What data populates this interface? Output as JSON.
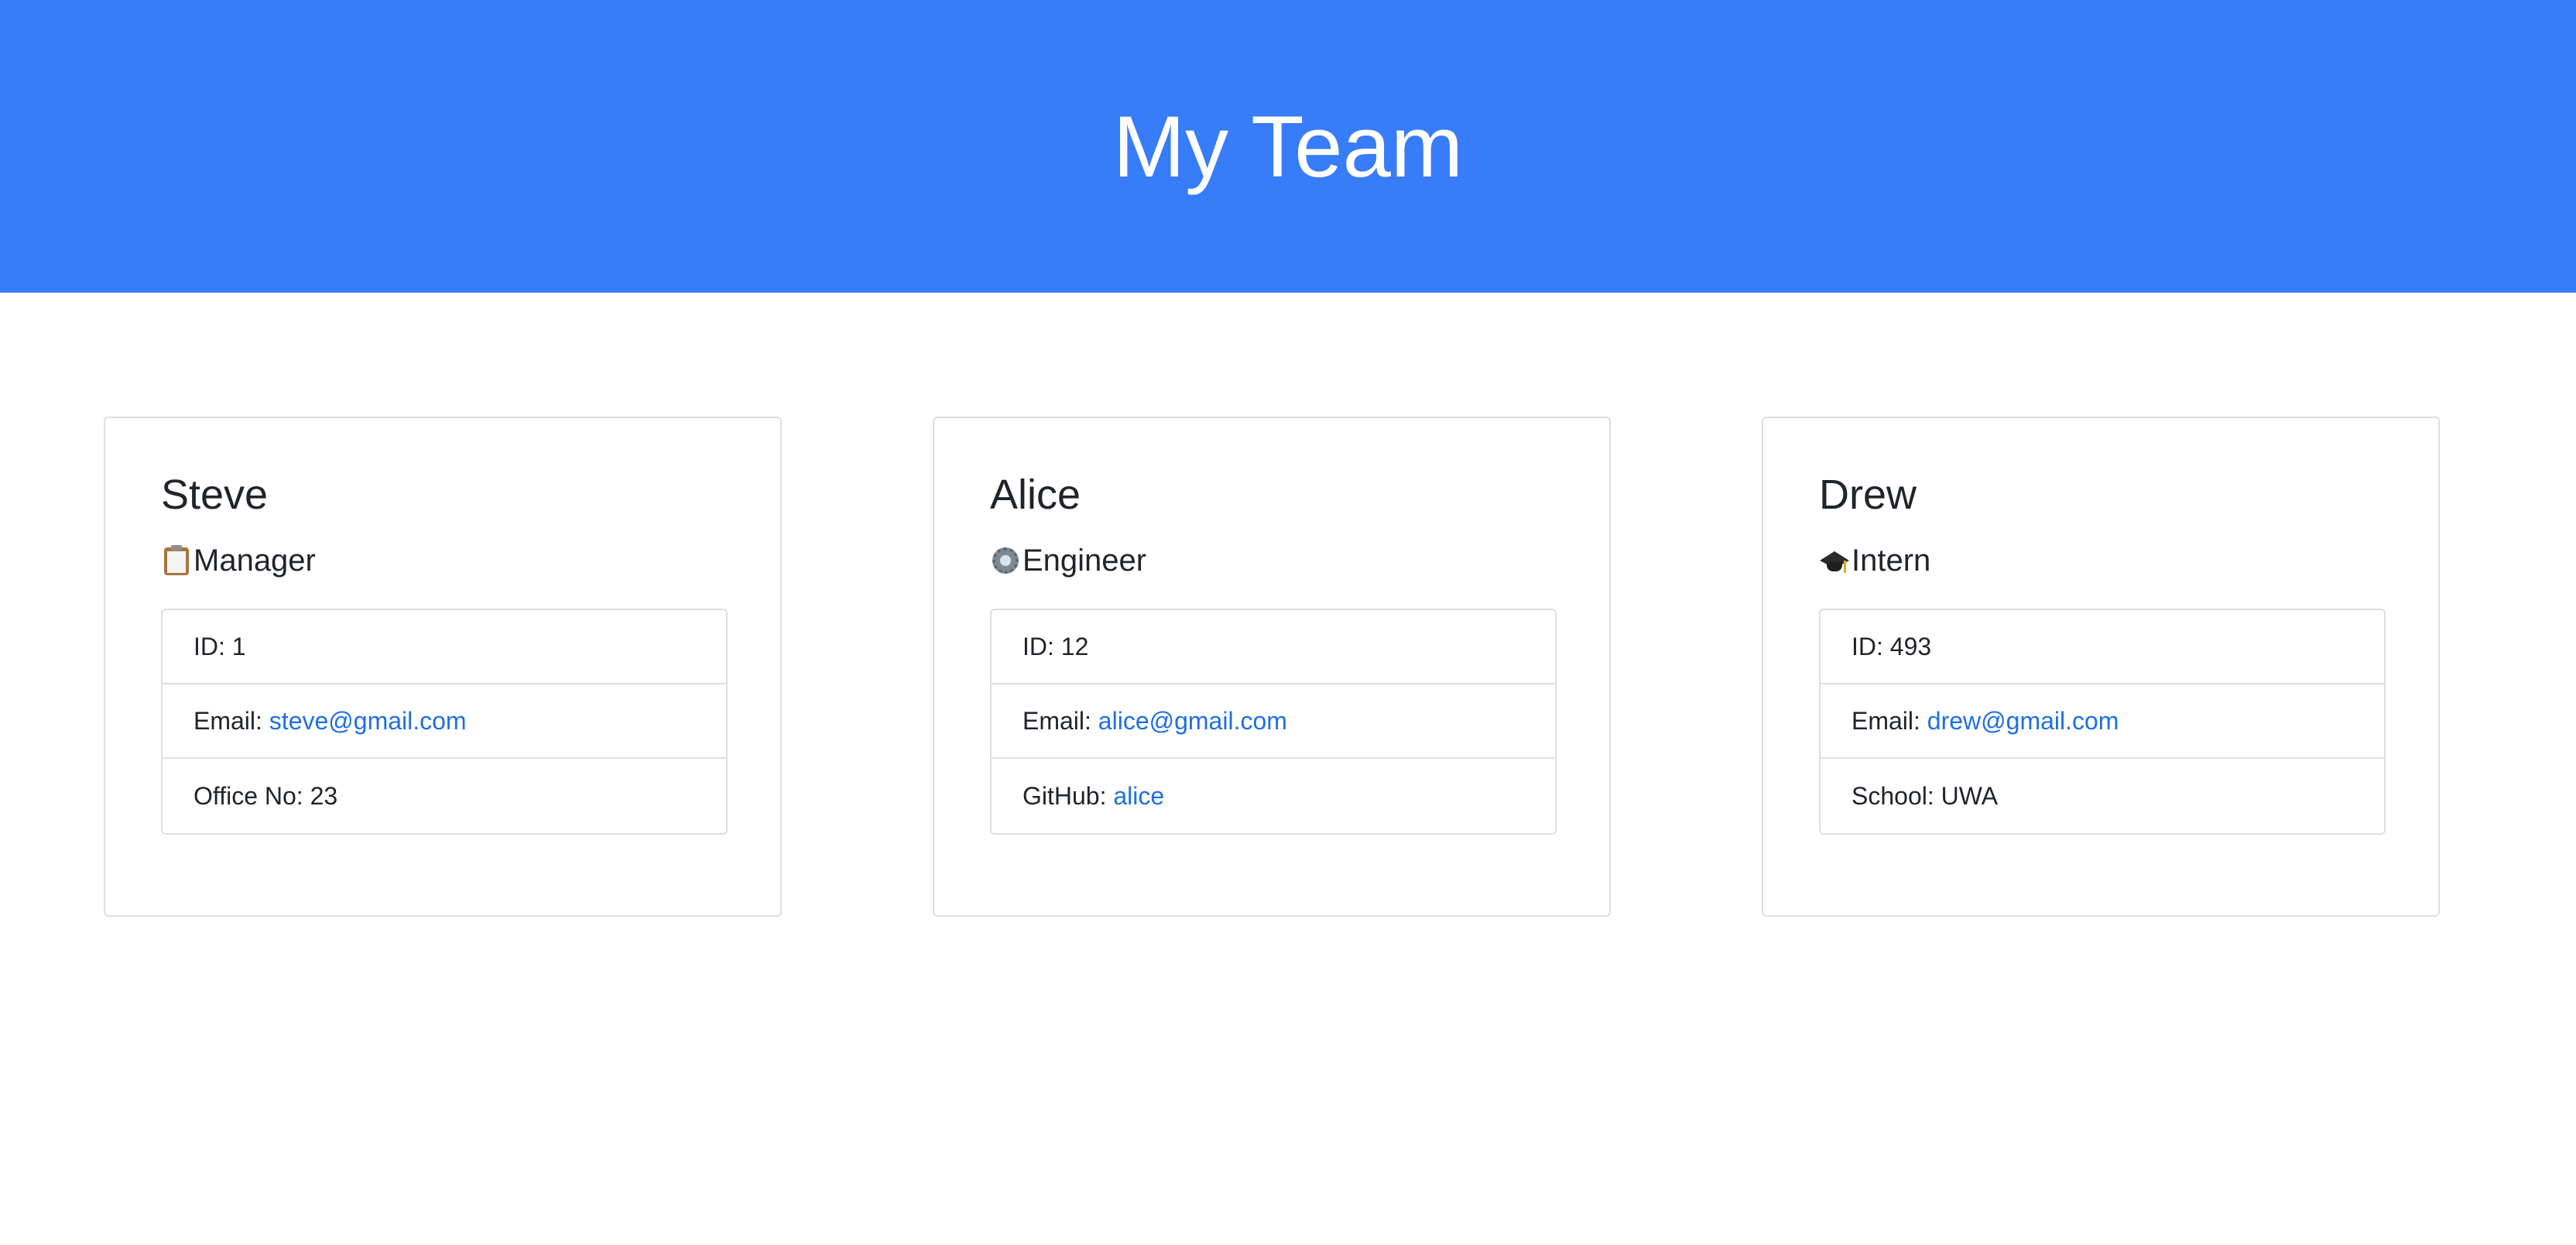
{
  "header": {
    "title": "My Team",
    "background_color": "#377cf8"
  },
  "colors": {
    "link": "#1f6fe5",
    "text": "#212529",
    "border": "#dcdfe3"
  },
  "team": [
    {
      "name": "Steve",
      "role": "Manager",
      "role_icon": "clipboard-icon",
      "id_label": "ID: 1",
      "email_label": "Email: ",
      "email": "steve@gmail.com",
      "extra_label": "Office No: 23",
      "extra_link": ""
    },
    {
      "name": "Alice",
      "role": "Engineer",
      "role_icon": "gear-icon",
      "id_label": "ID: 12",
      "email_label": "Email: ",
      "email": "alice@gmail.com",
      "extra_label": "GitHub: ",
      "extra_link": "alice"
    },
    {
      "name": "Drew",
      "role": "Intern",
      "role_icon": "graduation-cap-icon",
      "id_label": "ID: 493",
      "email_label": "Email: ",
      "email": "drew@gmail.com",
      "extra_label": "School: UWA",
      "extra_link": ""
    }
  ]
}
